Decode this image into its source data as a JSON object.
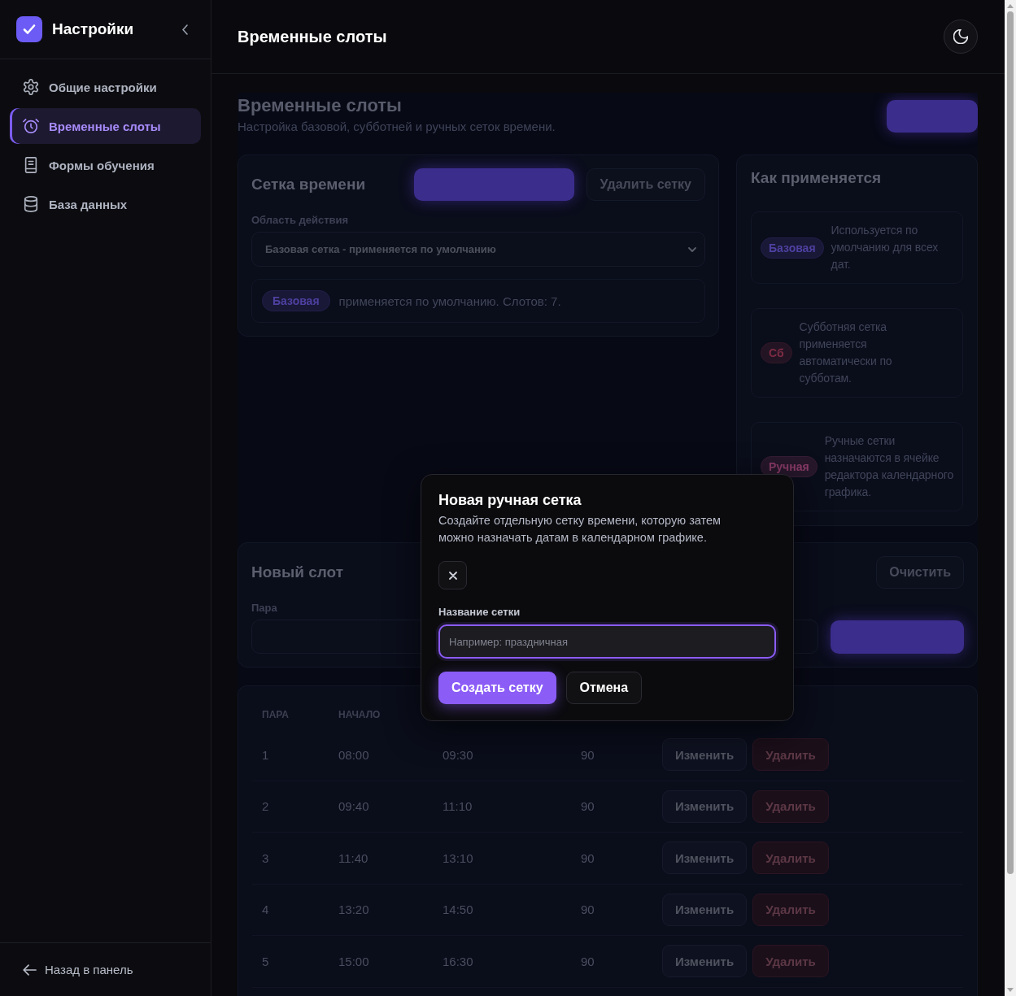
{
  "sidebar": {
    "title": "Настройки",
    "items": [
      {
        "label": "Общие настройки",
        "selected": false
      },
      {
        "label": "Временные слоты",
        "selected": true
      },
      {
        "label": "Формы обучения",
        "selected": false
      },
      {
        "label": "База данных",
        "selected": false
      }
    ],
    "back_link": "Назад в панель"
  },
  "header": {
    "title": "Временные слоты"
  },
  "page": {
    "title": "Временные слоты",
    "subtitle": "Настройка базовой, субботней и ручных сеток времени."
  },
  "grid_card": {
    "title": "Сетка времени",
    "delete_button": "Удалить сетку",
    "scope_label": "Область действия",
    "scope_value": "Базовая сетка - применяется по умолчанию",
    "info": {
      "badge": "Базовая",
      "color": "#4e40a0",
      "text": "применяется по умолчанию. Слотов: 7."
    }
  },
  "rules_card": {
    "title": "Как применяется",
    "items": [
      {
        "badge": "Базовая",
        "color": "#4e40a0",
        "text": "Используется по умолчанию для всех дат."
      },
      {
        "badge": "Сб",
        "color": "#7d2c44",
        "text": "Субботняя сетка применяется автоматически по субботам."
      },
      {
        "badge": "Ручная",
        "color": "#873a66",
        "text": "Ручные сетки назначаются в ячейке редактора календарного графика."
      }
    ]
  },
  "new_slot": {
    "title": "Новый слот",
    "clear_button": "Очистить",
    "fields": [
      {
        "kind": "labeled",
        "label": "Пара"
      },
      {
        "kind": "plain"
      }
    ]
  },
  "table": {
    "columns": [
      "ПАРА",
      "НАЧАЛО"
    ],
    "rows": [
      {
        "cells": [
          "1",
          "08:00",
          "09:30",
          "90"
        ],
        "actions": [
          {
            "kind": "edit",
            "label": "Изменить"
          },
          {
            "kind": "delete",
            "label": "Удалить"
          }
        ]
      },
      {
        "cells": [
          "2",
          "09:40",
          "11:10",
          "90"
        ],
        "actions": [
          {
            "kind": "edit",
            "label": "Изменить"
          },
          {
            "kind": "delete",
            "label": "Удалить"
          }
        ]
      },
      {
        "cells": [
          "3",
          "11:40",
          "13:10",
          "90"
        ],
        "actions": [
          {
            "kind": "edit",
            "label": "Изменить"
          },
          {
            "kind": "delete",
            "label": "Удалить"
          }
        ]
      },
      {
        "cells": [
          "4",
          "13:20",
          "14:50",
          "90"
        ],
        "actions": [
          {
            "kind": "edit",
            "label": "Изменить"
          },
          {
            "kind": "delete",
            "label": "Удалить"
          }
        ]
      },
      {
        "cells": [
          "5",
          "15:00",
          "16:30",
          "90"
        ],
        "actions": [
          {
            "kind": "edit",
            "label": "Изменить"
          },
          {
            "kind": "delete",
            "label": "Удалить"
          }
        ]
      }
    ]
  },
  "modal": {
    "title": "Новая ручная сетка",
    "description": "Создайте отдельную сетку времени, которую затем можно назначать датам в календарном графике.",
    "field": {
      "label": "Название сетки",
      "placeholder": "Например: праздничная",
      "focused": true
    },
    "buttons": [
      {
        "kind": "primary",
        "label": "Создать сетку"
      },
      {
        "kind": "secondary",
        "label": "Отмена"
      }
    ]
  }
}
